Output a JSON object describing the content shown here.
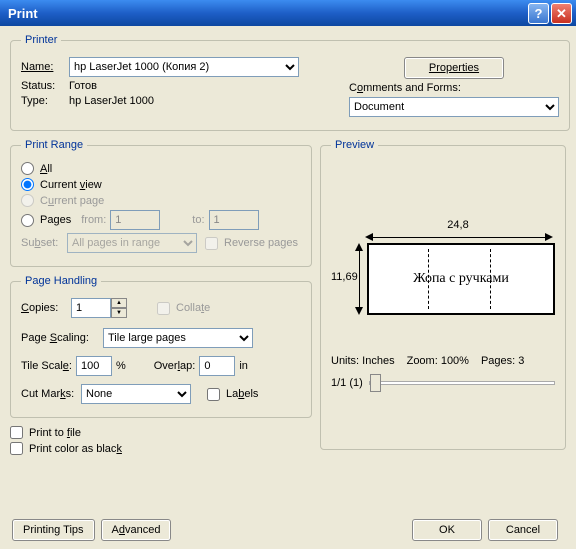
{
  "title": "Print",
  "printer": {
    "legend": "Printer",
    "name_label": "Name:",
    "name_value": "hp LaserJet 1000 (Копия 2)",
    "status_label": "Status:",
    "status_value": "Готов",
    "type_label": "Type:",
    "type_value": "hp LaserJet 1000",
    "properties_btn": "Properties",
    "comments_label": "Comments and Forms:",
    "comments_value": "Document"
  },
  "range": {
    "legend": "Print Range",
    "all": "All",
    "current_view": "Current view",
    "current_page": "Current page",
    "pages": "Pages",
    "from": "from:",
    "from_val": "1",
    "to": "to:",
    "to_val": "1",
    "subset_label": "Subset:",
    "subset_value": "All pages in range",
    "reverse": "Reverse pages"
  },
  "page": {
    "legend": "Page Handling",
    "copies": "Copies:",
    "copies_val": "1",
    "collate": "Collate",
    "scaling_label": "Page Scaling:",
    "scaling_value": "Tile large pages",
    "tile_scale": "Tile Scale:",
    "tile_scale_val": "100",
    "pct": "%",
    "overlap": "Overlap:",
    "overlap_val": "0",
    "ovunit": "in",
    "cut_marks": "Cut Marks:",
    "cut_marks_val": "None",
    "labels": "Labels"
  },
  "opts": {
    "print_to_file": "Print to file",
    "print_black": "Print color as black"
  },
  "preview": {
    "legend": "Preview",
    "width": "24,8",
    "height": "11,69",
    "doc_text": "Жопа с ручками",
    "units": "Units: Inches",
    "zoom": "Zoom: 100%",
    "pages": "Pages: 3",
    "progress": "1/1 (1)"
  },
  "footer": {
    "tips": "Printing Tips",
    "advanced": "Advanced",
    "ok": "OK",
    "cancel": "Cancel"
  }
}
